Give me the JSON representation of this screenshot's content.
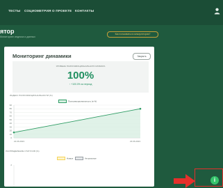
{
  "nav": {
    "items": [
      {
        "label": "ТЕСТЫ"
      },
      {
        "label": "СОЦИОМЕТРИЯ"
      },
      {
        "label": "О ПРОЕКТЕ"
      },
      {
        "label": "КОНТАКТЫ"
      }
    ],
    "user_icon": "user-icon"
  },
  "header": {
    "title": "ятор",
    "subtitle": "Мониторинг индекса и данных",
    "help_link": "Как пользоваться калькулятором?"
  },
  "card": {
    "title": "Мониторинг динамики",
    "button_label": "Закрыть",
    "summary": {
      "caption": "УРОВЕНЬ ПСИХОЭМОЦИОНАЛЬНОГО КЛИМАТА",
      "value": "100%",
      "delta": "↑ +100.0% за период"
    },
    "index_section_label": "ИНДЕКС ПСИХОЭМОЦИОНАЛЬНОСТИ (%)",
    "distribution_section_label": "РАСПРЕДЕЛЕНИЕ СТАТУСОВ (%)",
    "distribution_legend": [
      {
        "label": "Новые",
        "color": "#f5d45a"
      },
      {
        "label": "Актуальные",
        "color": "#9aa0a6"
      }
    ],
    "distribution_y_tick": "2"
  },
  "chart_data": {
    "type": "area",
    "x": [
      "22.06.2023",
      "23.06.2023"
    ],
    "series": [
      {
        "name": "Психоэмоциональность (в %)",
        "values": [
          15,
          80
        ],
        "color": "#2e9c64"
      }
    ],
    "yticks": [
      0,
      10,
      20,
      30,
      40,
      50,
      60,
      70,
      80,
      90
    ],
    "ylim": [
      0,
      90
    ],
    "grid": true,
    "legend": "top-center"
  },
  "colors": {
    "accent": "#2e9c64",
    "background": "#1f5a3e",
    "highlight": "#e5302c",
    "fab": "#35c46b"
  },
  "fab": {
    "icon": "info-icon",
    "glyph": "i"
  },
  "annotation": {
    "icon": "arrow-right-icon"
  }
}
